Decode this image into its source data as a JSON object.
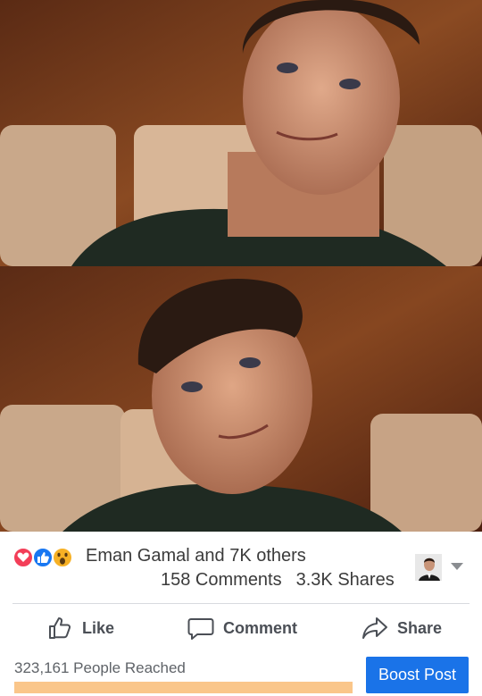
{
  "post": {
    "photos": [
      {
        "alt": "photo-1"
      },
      {
        "alt": "photo-2"
      }
    ],
    "reactions": {
      "icons": [
        "love-icon",
        "like-icon",
        "wow-icon"
      ],
      "reacted_by": "Eman Gamal and 7K others",
      "comments": "158 Comments",
      "shares": "3.3K Shares"
    },
    "actions": {
      "like_label": "Like",
      "comment_label": "Comment",
      "share_label": "Share"
    },
    "reach": {
      "label": "323,161 People Reached",
      "progress": 1.0
    },
    "boost_label": "Boost Post"
  },
  "colors": {
    "love": "#f33e58",
    "like": "#1877f2",
    "wow": "#f7b125",
    "boost": "#1a73e8",
    "reach_fill": "#fac68a"
  }
}
